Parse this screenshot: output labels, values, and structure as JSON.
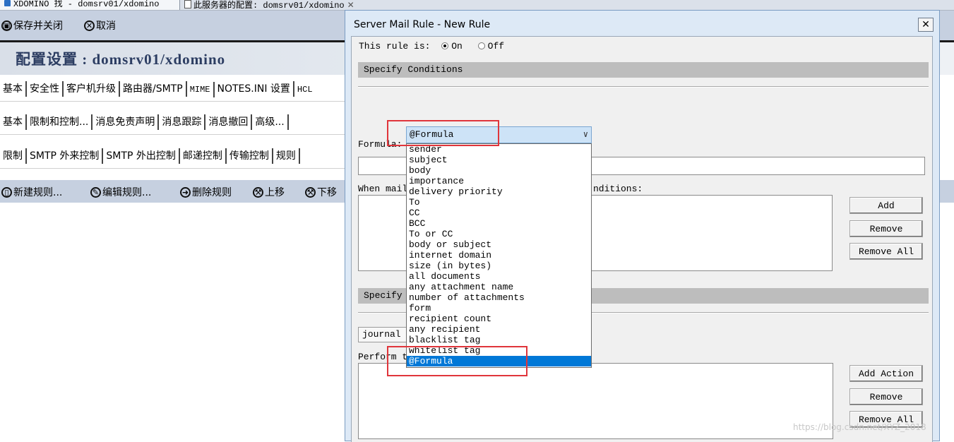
{
  "window_tabs": [
    {
      "label": "XDOMINO 找 - domsrv01/xdomino"
    },
    {
      "label": "此服务器的配置: domsrv01/xdomino"
    }
  ],
  "actionbar": {
    "save_close": "保存并关闭",
    "cancel": "取消"
  },
  "banner": {
    "title": "配置设置 : domsrv01/xdomino"
  },
  "tabs_row1": [
    "基本",
    "安全性",
    "客户机升级",
    "路由器/SMTP",
    "MIME",
    "NOTES.INI 设置",
    "HCL"
  ],
  "tabs_row2": [
    "基本",
    "限制和控制...",
    "消息免责声明",
    "消息跟踪",
    "消息撤回",
    "高级..."
  ],
  "tabs_row3": [
    "限制",
    "SMTP 外来控制",
    "SMTP 外出控制",
    "邮递控制",
    "传输控制",
    "规则"
  ],
  "toolbar": {
    "new_rule": "新建规则...",
    "edit_rule": "编辑规则...",
    "delete_rule": "删除规则",
    "move_up": "上移",
    "move_down": "下移"
  },
  "dialog": {
    "title": "Server Mail Rule - New Rule",
    "rule_is_label": "This rule is:",
    "on_label": "On",
    "off_label": "Off",
    "specify_conditions": "Specify Conditions",
    "combo_value": "@Formula",
    "formula_label": "Formula:",
    "when_mail_label": "When mail",
    "conditions_suffix": "nditions:",
    "specify_actions": "Specify A",
    "journal_value": "journal t",
    "perform_label": "Perform the following actions:",
    "buttons": {
      "add": "Add",
      "remove": "Remove",
      "remove_all": "Remove All",
      "add_action": "Add Action",
      "remove2": "Remove",
      "remove_all2": "Remove All"
    },
    "dropdown_items": [
      "sender",
      "subject",
      "body",
      "importance",
      "delivery priority",
      "To",
      "CC",
      "BCC",
      "To or CC",
      "body or subject",
      "internet domain",
      "size (in bytes)",
      "all documents",
      "any attachment name",
      "number of attachments",
      "form",
      "recipient count",
      "any recipient",
      "blacklist tag",
      "whitelist tag",
      "@Formula"
    ],
    "selected_item": "@Formula"
  },
  "watermark": "https://blog.csdn.net/XYZ_2018"
}
